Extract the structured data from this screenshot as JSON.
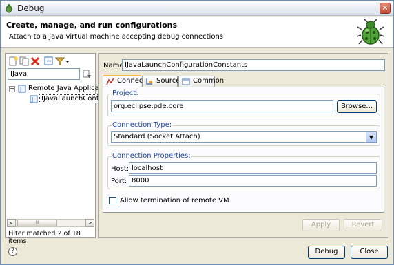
{
  "window": {
    "title": "Debug",
    "close_glyph": "✕"
  },
  "banner": {
    "heading": "Create, manage, and run configurations",
    "subtitle": "Attach to a Java virtual machine accepting debug connections",
    "icon": "bug-icon"
  },
  "left": {
    "toolbar_icons": [
      "new-config-icon",
      "duplicate-icon",
      "delete-icon",
      "collapse-all-icon",
      "filter-icon",
      "dropdown-arrow-icon"
    ],
    "filter_value": "IJava",
    "tree": [
      {
        "label": "Remote Java Application",
        "expander": "−",
        "level": 0
      },
      {
        "label": "IJavaLaunchConfigur",
        "level": 1
      }
    ],
    "status": "Filter matched 2 of 18 items",
    "scroll_left": "<",
    "scroll_right": ">",
    "scroll_thumb_glyph": "III"
  },
  "right": {
    "name_label": "Name:",
    "name_value": "IJavaLaunchConfigurationConstants",
    "tabs": [
      {
        "label": "Connect",
        "icon": "connect-icon",
        "active": true
      },
      {
        "label": "Source",
        "icon": "source-icon",
        "active": false
      },
      {
        "label": "Common",
        "icon": "common-icon",
        "active": false
      }
    ],
    "project": {
      "legend": "Project:",
      "value": "org.eclipse.pde.core",
      "browse_label": "Browse..."
    },
    "connection_type": {
      "legend": "Connection Type:",
      "selected": "Standard (Socket Attach)"
    },
    "connection_props": {
      "legend": "Connection Properties:",
      "host_label": "Host:",
      "host_value": "localhost",
      "port_label": "Port:",
      "port_value": "8000"
    },
    "allow_termination": {
      "label": "Allow termination of remote VM",
      "checked": false
    },
    "apply_label": "Apply",
    "revert_label": "Revert"
  },
  "footer": {
    "help_glyph": "?",
    "debug_label": "Debug",
    "close_label": "Close"
  }
}
